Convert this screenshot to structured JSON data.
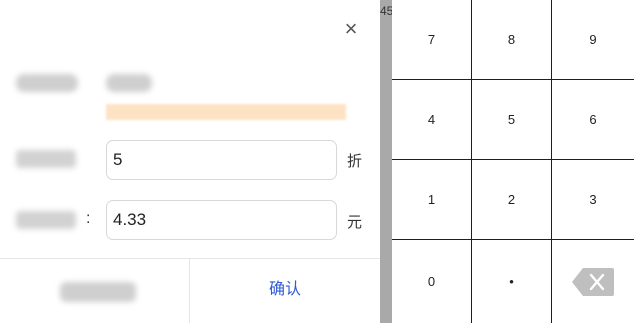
{
  "dialog": {
    "discount_value": "5",
    "discount_unit": "折",
    "amount_value": "4.33",
    "amount_colon": ":",
    "amount_unit": "元",
    "confirm_label": "确认"
  },
  "keypad": {
    "keys": [
      "7",
      "8",
      "9",
      "4",
      "5",
      "6",
      "1",
      "2",
      "3",
      "0",
      "•"
    ],
    "backspace_icon": "backspace-icon"
  },
  "background": {
    "fragment": "45"
  }
}
